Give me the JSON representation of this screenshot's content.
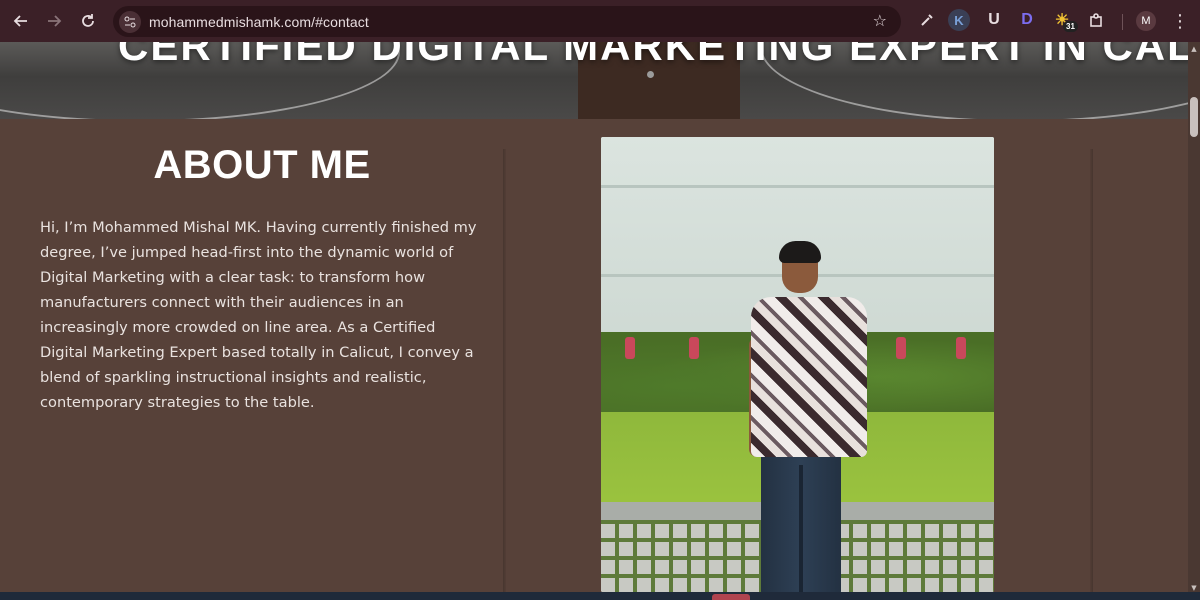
{
  "browser": {
    "url": "mohammedmishamk.com/#contact",
    "extensions": [
      {
        "name": "eyedropper-extension",
        "glyph": "✎",
        "color": "#e8dde0"
      },
      {
        "name": "k-extension",
        "glyph": "K",
        "color": "#7aa0d8"
      },
      {
        "name": "u-extension",
        "glyph": "U",
        "color": "#e8dde0"
      },
      {
        "name": "d-extension",
        "glyph": "D",
        "color": "#7c6df0"
      },
      {
        "name": "calendar-extension",
        "glyph": "☀",
        "color": "#f1c232",
        "badge": "31"
      },
      {
        "name": "extensions-menu",
        "glyph": "⧉",
        "color": "#e8dde0"
      }
    ],
    "profile_initial": "M",
    "icons": {
      "back": "back-arrow-icon",
      "forward": "forward-arrow-icon",
      "reload": "reload-icon",
      "site_settings": "tune-icon",
      "bookmark": "star-icon",
      "menu": "more-vert-icon"
    }
  },
  "hero": {
    "headline": "CERTIFIED DIGITAL MARKETING EXPERT IN CALICUT"
  },
  "about": {
    "title": "ABOUT ME",
    "body": "Hi, I’m Mohammed Mishal MK. Having currently finished my degree, I’ve jumped head-first into the dynamic world of Digital Marketing with a clear task: to transform how manufacturers connect with their audiences in an increasingly more crowded on line area. As a Certified Digital Marketing Expert based totally in Calicut, I convey a blend of sparkling instructional insights and realistic, contemporary strategies to the table."
  },
  "colors": {
    "page_bg": "#574139",
    "chrome_bg": "#3b2027",
    "omnibox_bg": "#2a1419",
    "heading": "#ffffff",
    "body_text": "#e9e2df"
  }
}
